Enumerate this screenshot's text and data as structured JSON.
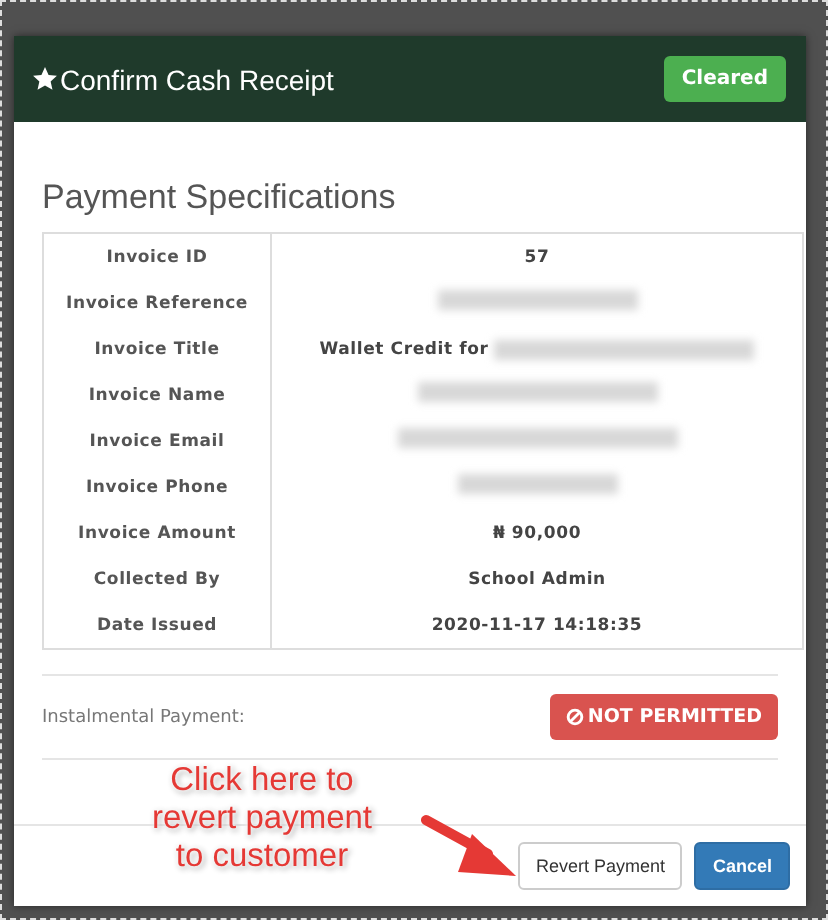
{
  "modal": {
    "title": "Confirm Cash Receipt",
    "status_badge": "Cleared"
  },
  "section_title": "Payment Specifications",
  "rows": [
    {
      "label": "Invoice ID",
      "value": "57",
      "redacted": false
    },
    {
      "label": "Invoice Reference",
      "redacted": true
    },
    {
      "label": "Invoice Title",
      "value": "Wallet Credit for",
      "redacted": true
    },
    {
      "label": "Invoice Name",
      "redacted": true
    },
    {
      "label": "Invoice Email",
      "redacted": true
    },
    {
      "label": "Invoice Phone",
      "redacted": true
    },
    {
      "label": "Invoice Amount",
      "value": "₦ 90,000",
      "redacted": false
    },
    {
      "label": "Collected By",
      "value": "School Admin",
      "redacted": false
    },
    {
      "label": "Date Issued",
      "value": "2020-11-17 14:18:35",
      "redacted": false
    }
  ],
  "instalmental": {
    "label": "Instalmental Payment:",
    "status": "NOT PERMITTED"
  },
  "annotation": "Click here to revert payment to customer",
  "buttons": [
    {
      "label": "Revert Payment",
      "kind": "default"
    },
    {
      "label": "Cancel",
      "kind": "primary"
    }
  ]
}
